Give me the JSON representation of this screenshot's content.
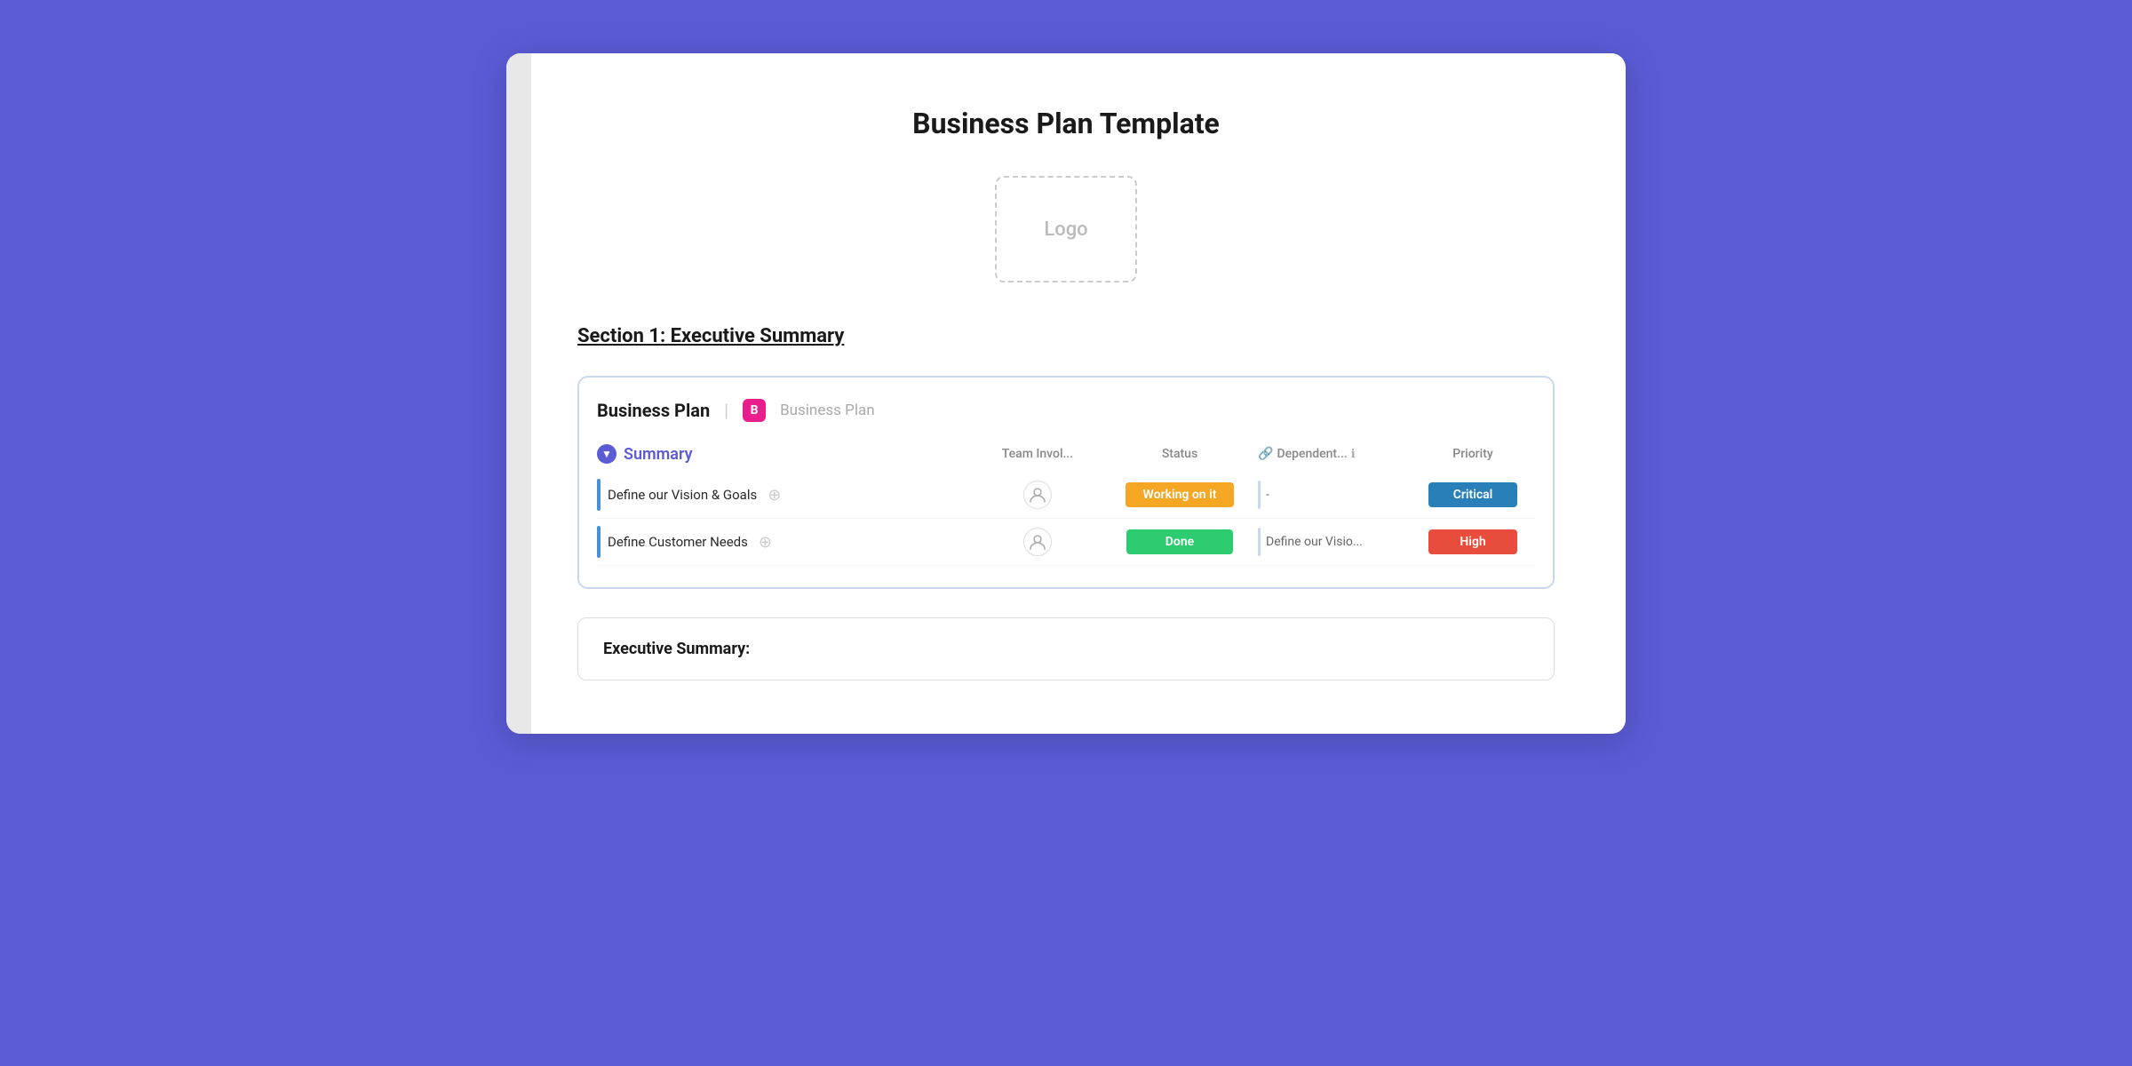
{
  "document": {
    "title": "Business Plan Template",
    "logo_placeholder": "Logo",
    "section_heading": "Section 1: Executive Summary"
  },
  "board": {
    "title": "Business Plan",
    "separator": "|",
    "badge_letter": "B",
    "badge_label": "Business Plan",
    "group_label": "Summary",
    "columns": {
      "task": "",
      "team": "Team Invol...",
      "status": "Status",
      "depends": "Dependent...",
      "priority": "Priority"
    },
    "tasks": [
      {
        "name": "Define our Vision & Goals",
        "status": "Working on it",
        "status_class": "status-working",
        "depends": "-",
        "priority": "Critical",
        "priority_class": "priority-critical"
      },
      {
        "name": "Define Customer Needs",
        "status": "Done",
        "status_class": "status-done",
        "depends": "Define our Visio...",
        "priority": "High",
        "priority_class": "priority-high"
      }
    ]
  },
  "exec_summary": {
    "title": "Executive Summary:"
  }
}
